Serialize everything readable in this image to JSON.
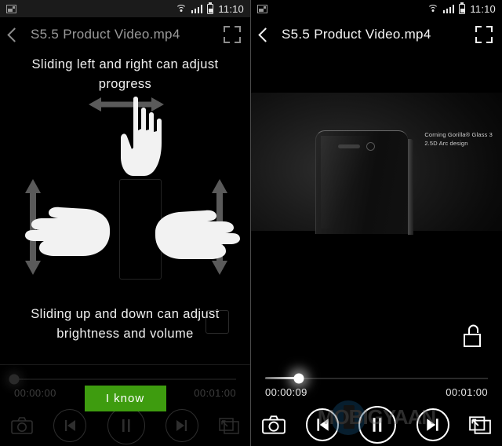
{
  "status_bar": {
    "notification_icon": "photo-icon",
    "wifi_icon": "wifi-icon",
    "signal_icon": "signal-bars-icon",
    "battery_icon": "battery-icon",
    "clock": "11:10"
  },
  "left_panel": {
    "title": "S5.5 Product Video.mp4",
    "back_icon": "back-chevron-icon",
    "expand_icon": "expand-icon",
    "tutorial": {
      "top_text": "Sliding left and right can adjust progress",
      "bottom_text": "Sliding up and down can adjust brightness and volume",
      "horizontal_arrow_icon": "horizontal-double-arrow-icon",
      "vertical_arrow_icon": "vertical-double-arrow-icon",
      "hand_icon": "hand-gesture-icon"
    },
    "confirm_button": "I know",
    "controls": {
      "current_time": "00:00:00",
      "total_time": "00:01:00",
      "progress_percent": 0,
      "screenshot_icon": "camera-icon",
      "previous_icon": "skip-previous-icon",
      "play_pause_icon": "pause-icon",
      "next_icon": "skip-next-icon",
      "popup_icon": "popup-window-icon"
    }
  },
  "right_panel": {
    "title": "S5.5 Product Video.mp4",
    "back_icon": "back-chevron-icon",
    "expand_icon": "expand-icon",
    "video": {
      "caption_line1": "Corning Gorilla® Glass 3",
      "caption_line2": "2.5D Arc design",
      "lock_icon": "unlock-icon"
    },
    "controls": {
      "current_time": "00:00:09",
      "total_time": "00:01:00",
      "progress_percent": 15,
      "screenshot_icon": "camera-icon",
      "previous_icon": "skip-previous-icon",
      "play_pause_icon": "pause-icon",
      "next_icon": "skip-next-icon",
      "popup_icon": "popup-window-icon"
    },
    "watermark": "MOBIGYAAN"
  },
  "colors": {
    "accent_green": "#3e9c0f",
    "background": "#000000",
    "active_text": "#f5f5f5",
    "inactive_text": "#8d8d8d"
  }
}
